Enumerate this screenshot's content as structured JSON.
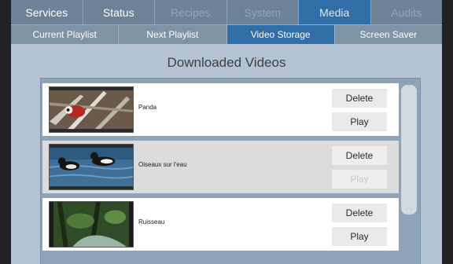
{
  "main_tabs": [
    {
      "label": "Services",
      "state": "enabled"
    },
    {
      "label": "Status",
      "state": "enabled"
    },
    {
      "label": "Recipes",
      "state": "disabled"
    },
    {
      "label": "System",
      "state": "disabled"
    },
    {
      "label": "Media",
      "state": "active"
    },
    {
      "label": "Audits",
      "state": "disabled"
    }
  ],
  "sub_tabs": [
    {
      "label": "Current Playlist",
      "state": "enabled"
    },
    {
      "label": "Next Playlist",
      "state": "enabled"
    },
    {
      "label": "Video Storage",
      "state": "active"
    },
    {
      "label": "Screen Saver",
      "state": "enabled"
    }
  ],
  "page": {
    "title": "Downloaded Videos"
  },
  "videos": [
    {
      "title": "Panda",
      "delete_label": "Delete",
      "play_label": "Play",
      "play_enabled": true
    },
    {
      "title": "Oiseaux sur l'eau",
      "delete_label": "Delete",
      "play_label": "Play",
      "play_enabled": false
    },
    {
      "title": "Ruisseau",
      "delete_label": "Delete",
      "play_label": "Play",
      "play_enabled": true
    }
  ],
  "colors": {
    "tab_bar": "#6d8297",
    "active_tab": "#2f6ea6",
    "background": "#b4c3d4"
  }
}
